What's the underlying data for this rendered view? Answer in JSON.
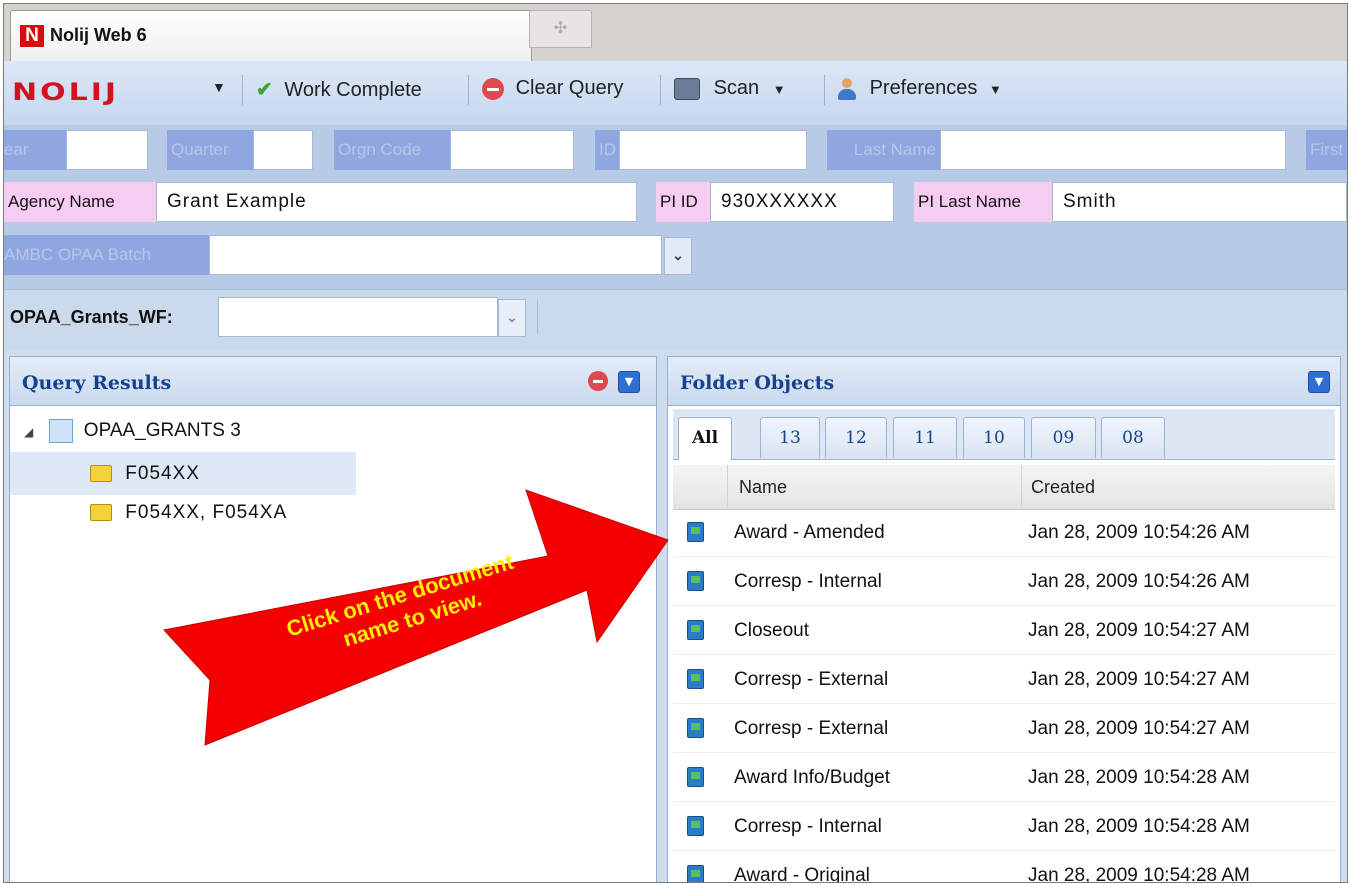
{
  "window": {
    "tab_title": "Nolij Web 6",
    "tab_logo": "N",
    "new_tab_icon": "move-icon"
  },
  "toolbar": {
    "logo": "NOLIJ",
    "work_complete": "Work Complete",
    "clear_query": "Clear Query",
    "scan": "Scan",
    "preferences": "Preferences"
  },
  "query_fields": {
    "row1": [
      "Year",
      "Quarter",
      "Orgn Code",
      "ID",
      "Last Name",
      "First"
    ],
    "agency_name_label": "Agency Name",
    "agency_name_value": "Grant Example",
    "pi_id_label": "PI ID",
    "pi_id_value": "930XXXXXX",
    "pi_last_name_label": "PI Last Name",
    "pi_last_name_value": "Smith",
    "batch_label": "AMBC OPAA Batch"
  },
  "workflow": {
    "label": "OPAA_Grants_WF:"
  },
  "query_results": {
    "title": "Query Results",
    "root": "OPAA_GRANTS 3",
    "items": [
      "F054XX",
      "F054XX, F054XA"
    ]
  },
  "folder_objects": {
    "title": "Folder Objects",
    "tabs": [
      "All",
      "13",
      "12",
      "11",
      "10",
      "09",
      "08"
    ],
    "columns": [
      "Name",
      "Created"
    ],
    "rows": [
      {
        "name": "Award - Amended",
        "created": "Jan 28, 2009 10:54:26 AM"
      },
      {
        "name": "Corresp - Internal",
        "created": "Jan 28, 2009 10:54:26 AM"
      },
      {
        "name": "Closeout",
        "created": "Jan 28, 2009 10:54:27 AM"
      },
      {
        "name": "Corresp - External",
        "created": "Jan 28, 2009 10:54:27 AM"
      },
      {
        "name": "Corresp - External",
        "created": "Jan 28, 2009 10:54:27 AM"
      },
      {
        "name": "Award Info/Budget",
        "created": "Jan 28, 2009 10:54:28 AM"
      },
      {
        "name": "Corresp - Internal",
        "created": "Jan 28, 2009 10:54:28 AM"
      },
      {
        "name": "Award - Original",
        "created": "Jan 28, 2009 10:54:28 AM"
      }
    ]
  },
  "annotation": {
    "line1": "Click on the document",
    "line2": "name to view."
  },
  "colors": {
    "brand": "#d4121e",
    "accent": "#15428b",
    "arrow": "#f40000",
    "arrow_text": "#ffee00"
  }
}
